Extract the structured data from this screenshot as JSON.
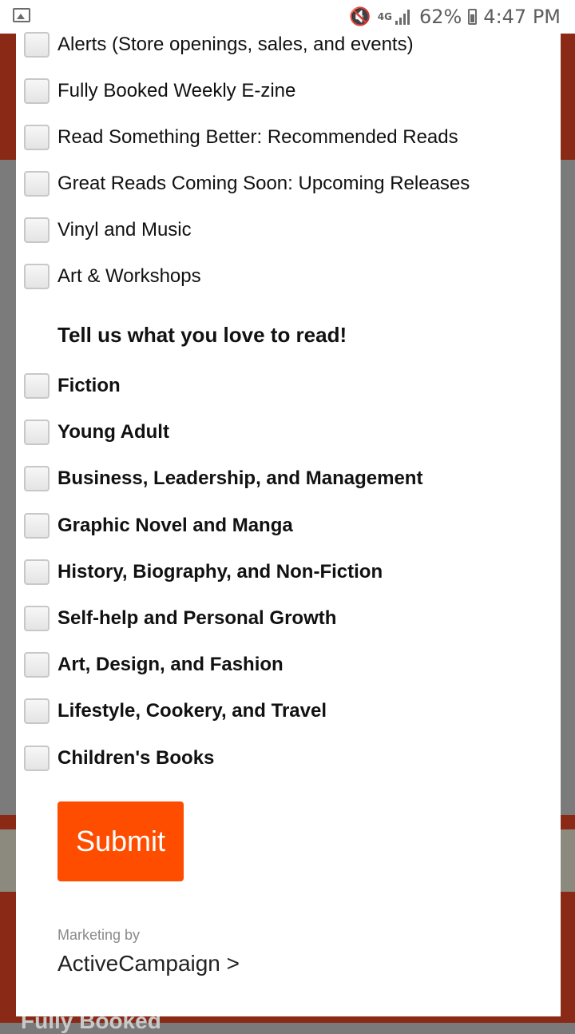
{
  "status_bar": {
    "network": "4G",
    "battery": "62%",
    "time": "4:47 PM"
  },
  "background": {
    "footer_text": "Fully Booked"
  },
  "form": {
    "subscriptions": [
      "Alerts (Store openings, sales, and events)",
      "Fully Booked Weekly E-zine",
      "Read Something Better: Recommended Reads",
      "Great Reads Coming Soon: Upcoming Releases",
      "Vinyl and Music",
      "Art & Workshops"
    ],
    "genres_heading": "Tell us what you love to read!",
    "genres": [
      "Fiction",
      "Young Adult",
      "Business, Leadership, and Management",
      "Graphic Novel and Manga",
      "History, Biography, and Non-Fiction",
      "Self-help and Personal Growth",
      "Art, Design, and Fashion",
      "Lifestyle, Cookery, and Travel",
      "Children's Books"
    ],
    "submit_label": "Submit",
    "marketing_by": "Marketing by",
    "provider": "ActiveCampaign >"
  }
}
